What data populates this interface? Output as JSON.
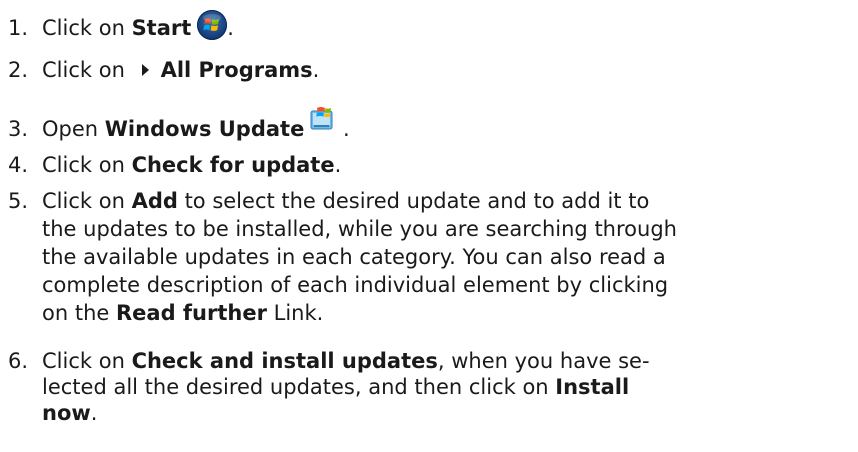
{
  "steps": [
    {
      "number": "1.",
      "lines": [
        [
          {
            "t": "Click on "
          },
          {
            "t": "Start",
            "b": true
          },
          {
            "icon": "windows-start-orb-icon"
          },
          {
            "t": "."
          }
        ]
      ]
    },
    {
      "number": "2.",
      "lines": [
        [
          {
            "t": "Click on "
          },
          {
            "icon": "triangle-right-icon"
          },
          {
            "t": "All Programs",
            "b": true
          },
          {
            "t": "."
          }
        ]
      ]
    },
    {
      "number": "3.",
      "lines": [
        [
          {
            "t": "Open "
          },
          {
            "t": "Windows Update",
            "b": true
          },
          {
            "icon": "windows-update-icon"
          },
          {
            "t": " ."
          }
        ]
      ]
    },
    {
      "number": "4.",
      "lines": [
        [
          {
            "t": "Click on "
          },
          {
            "t": "Check for update",
            "b": true
          },
          {
            "t": "."
          }
        ]
      ]
    },
    {
      "number": "5.",
      "lines": [
        [
          {
            "t": "Click on "
          },
          {
            "t": "Add",
            "b": true
          },
          {
            "t": " to select the desired update and to add it to"
          }
        ],
        [
          {
            "t": "the updates to be installed, while you are searching through"
          }
        ],
        [
          {
            "t": "the available updates in each category. You can also read a"
          }
        ],
        [
          {
            "t": "complete description of each individual element by clicking"
          }
        ],
        [
          {
            "t": "on the "
          },
          {
            "t": "Read further",
            "b": true
          },
          {
            "t": " Link."
          }
        ]
      ]
    },
    {
      "number": "6.",
      "lines": [
        [
          {
            "t": "Click on "
          },
          {
            "t": "Check and install updates",
            "b": true
          },
          {
            "t": ", when you have se-"
          }
        ],
        [
          {
            "t": "lected all the desired updates, and then click on "
          },
          {
            "t": "Install",
            "b": true
          }
        ],
        [
          {
            "t": "now",
            "b": true
          },
          {
            "t": "."
          }
        ]
      ]
    }
  ]
}
